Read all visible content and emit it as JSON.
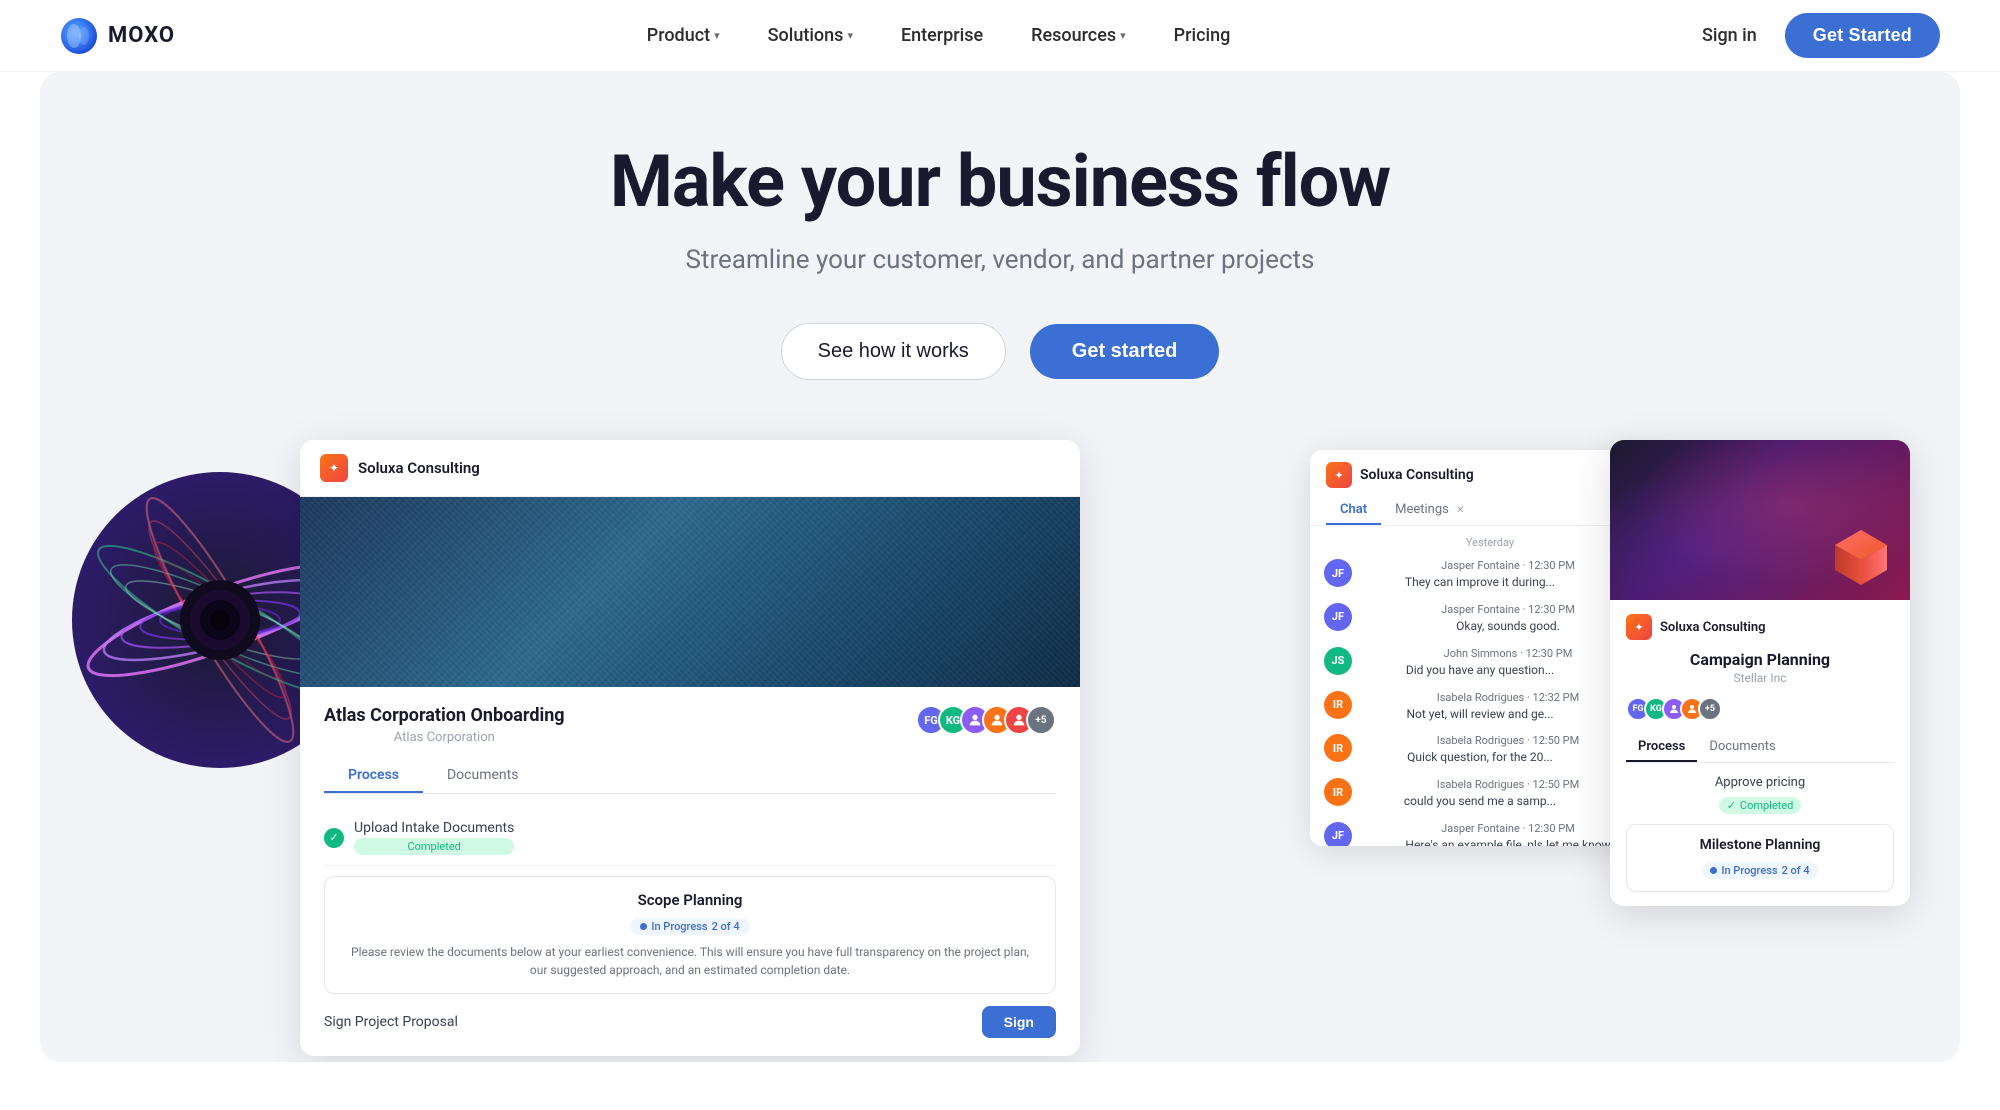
{
  "brand": {
    "name": "MOXO",
    "logo_alt": "Moxo logo"
  },
  "nav": {
    "product": "Product",
    "solutions": "Solutions",
    "enterprise": "Enterprise",
    "resources": "Resources",
    "pricing": "Pricing",
    "sign_in": "Sign in",
    "get_started": "Get Started"
  },
  "hero": {
    "title": "Make your business flow",
    "subtitle": "Streamline your customer, vendor, and partner projects",
    "cta_secondary": "See how it works",
    "cta_primary": "Get started"
  },
  "main_card": {
    "company": "Soluxa Consulting",
    "project_title": "Atlas Corporation Onboarding",
    "project_sub": "Atlas Corporation",
    "tab_process": "Process",
    "tab_documents": "Documents",
    "step1_label": "Upload Intake Documents",
    "step1_status": "Completed",
    "scope_title": "Scope Planning",
    "scope_badge": "In Progress",
    "scope_progress": "2 of 4",
    "scope_text": "Please review the documents below at your earliest convenience. This will ensure you have full transparency on the project plan, our suggested approach, and an estimated completion date.",
    "step2_label": "Sign Project Proposal"
  },
  "chat_card": {
    "company": "Soluxa Consulting",
    "tab_chat": "Chat",
    "tab_meetings": "Meetings",
    "date_label": "Yesterday",
    "messages": [
      {
        "sender": "Jasper Fontaine - 12:30 PM",
        "text": "They can improve it during...",
        "avatar_color": "#6366f1",
        "initials": "JF"
      },
      {
        "sender": "Jasper Fontaine - 12:30 PM",
        "text": "Okay, sounds good.",
        "avatar_color": "#6366f1",
        "initials": "JF"
      },
      {
        "sender": "John Simmons - 12:30 PM",
        "text": "Did you have any question...",
        "avatar_color": "#10b981",
        "initials": "JS"
      },
      {
        "sender": "Isabela Rodrigues - 12:32 PM",
        "text": "Not yet, will review and ge...",
        "avatar_color": "#f97316",
        "initials": "IR"
      },
      {
        "sender": "Isabela Rodrigues - 12:50 PM",
        "text": "Quick question, for the 20...",
        "avatar_color": "#f97316",
        "initials": "IR"
      },
      {
        "sender": "Isabela Rodrigues - 12:50 PM",
        "text": "could you send me a samp...",
        "avatar_color": "#f97316",
        "initials": "IR"
      },
      {
        "sender": "Jasper Fontaine - 12:30 PM",
        "text": "Here's an example file, pls let me know",
        "avatar_color": "#6366f1",
        "initials": "JF"
      }
    ]
  },
  "campaign_card": {
    "title": "Campaign Planning",
    "sub": "Stellar Inc",
    "tab_process": "Process",
    "tab_documents": "Documents",
    "step1_label": "Approve pricing",
    "step1_status": "Completed",
    "milestone_title": "Milestone Planning",
    "milestone_badge": "In Progress",
    "milestone_progress": "2 of 4",
    "avatars": [
      "FG",
      "KG",
      "+5"
    ]
  }
}
